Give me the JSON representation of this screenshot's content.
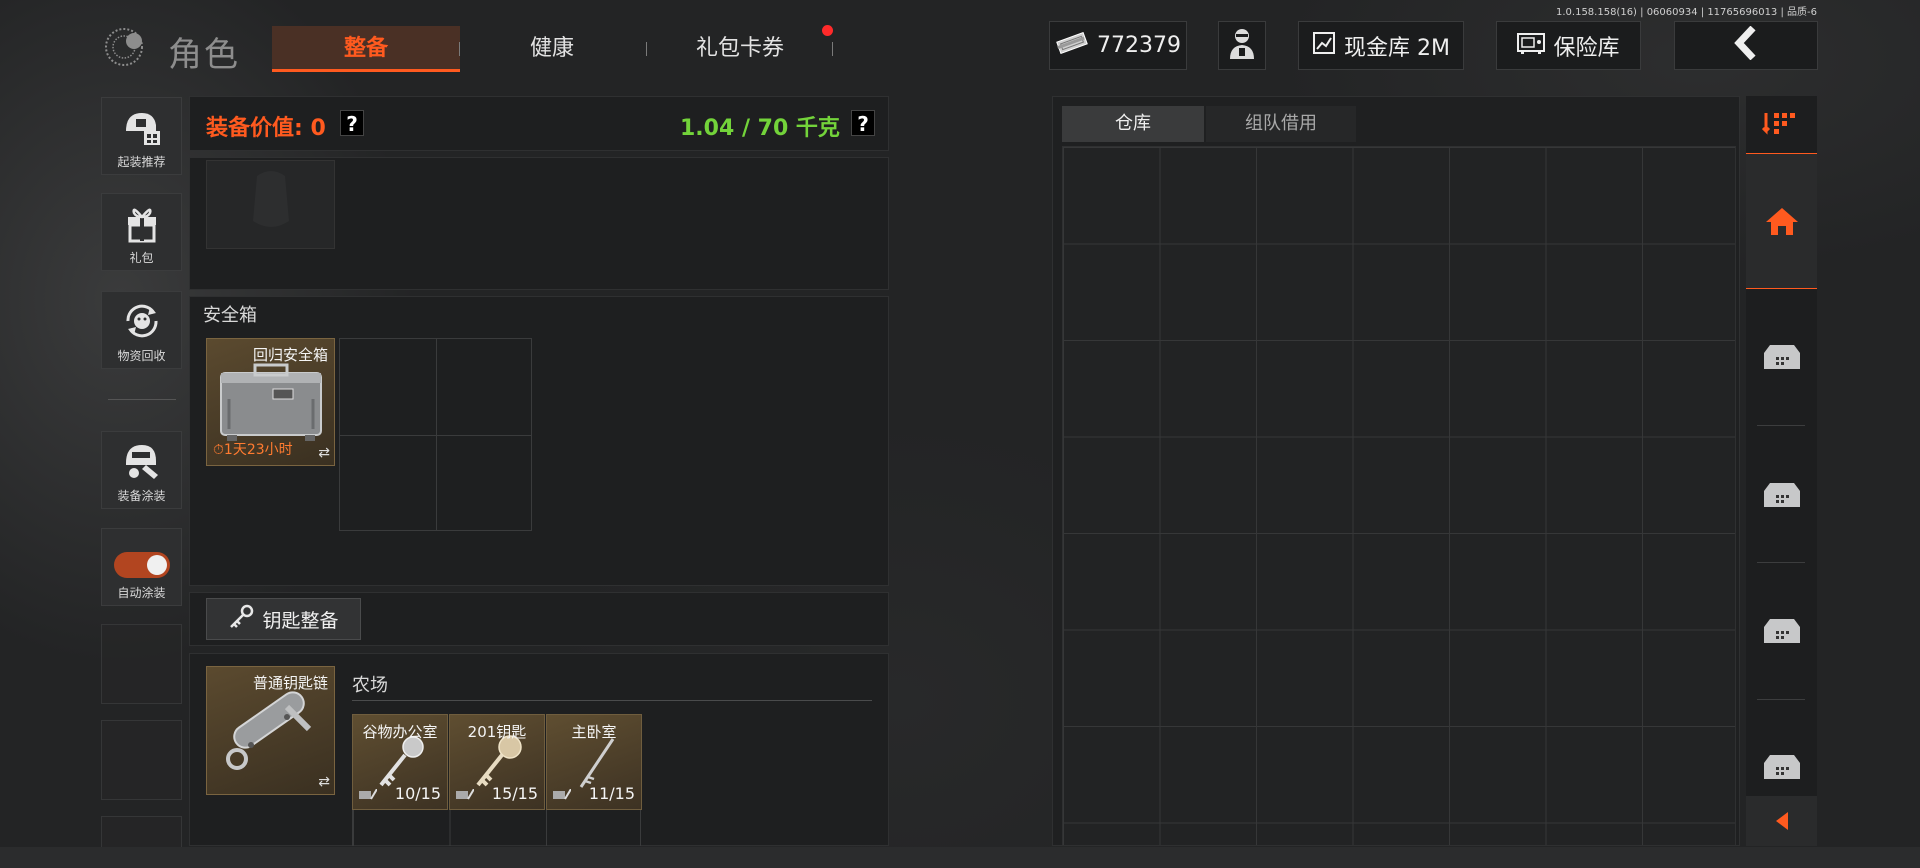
{
  "version": "1.0.158.158(16) | 06060934 | 11765696013 | 品质-6",
  "header": {
    "title": "角色",
    "tabs": [
      {
        "label": "整备",
        "active": true
      },
      {
        "label": "健康",
        "active": false
      },
      {
        "label": "礼包卡券",
        "active": false,
        "notification": true
      }
    ],
    "currency": "772379",
    "cash_vault": "现金库 2M",
    "safe_vault": "保险库",
    "back_icon": "chevron-left-icon"
  },
  "sidebar": {
    "items": [
      {
        "label": "起装推荐",
        "icon": "helmet-gear-icon"
      },
      {
        "label": "礼包",
        "icon": "gift-icon"
      },
      {
        "label": "物资回收",
        "icon": "recycle-icon"
      },
      {
        "label": "装备涂装",
        "icon": "paint-helmet-icon"
      },
      {
        "label": "自动涂装",
        "icon": "toggle-switch",
        "toggle_on": true
      }
    ]
  },
  "equipment": {
    "value_label": "装备价值: 0",
    "weight_label": "1.04 / 70 千克",
    "safebox": {
      "title": "安全箱",
      "item_name": "回归安全箱",
      "timer": "1天23小时"
    },
    "keys": {
      "button_label": "钥匙整备",
      "chain_name": "普通钥匙链",
      "map_name": "农场",
      "cards": [
        {
          "name": "谷物办公室",
          "count": "10/15"
        },
        {
          "name": "201钥匙",
          "count": "15/15"
        },
        {
          "name": "主卧室",
          "count": "11/15"
        }
      ]
    }
  },
  "storage": {
    "tabs": [
      {
        "label": "仓库",
        "active": true
      },
      {
        "label": "组队借用",
        "active": false
      }
    ]
  },
  "colors": {
    "accent": "#ff5a1f",
    "weight_green": "#73d33a",
    "item_gold": "#5b4a2f"
  }
}
